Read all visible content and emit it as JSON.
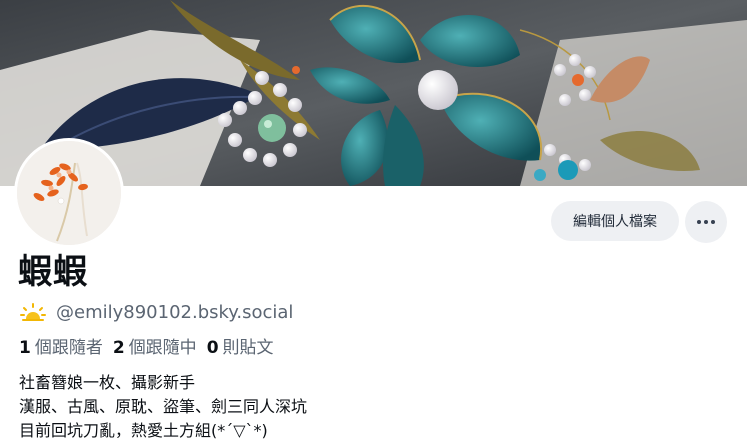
{
  "profile": {
    "display_name": "蝦蝦",
    "handle": "@emily890102.bsky.social",
    "handle_icon": "sun-cloud-emoji-icon"
  },
  "actions": {
    "edit_label": "編輯個人檔案",
    "more_icon": "more-dots-icon"
  },
  "stats": {
    "followers_count": "1",
    "followers_label": "個跟隨者",
    "following_count": "2",
    "following_label": "個跟隨中",
    "posts_count": "0",
    "posts_label": "則貼文"
  },
  "bio": [
    "社畜簪娘一枚、攝影新手",
    "漢服、古風、原耽、盜筆、劍三同人深坑",
    "目前回坑刀亂，熱愛土方組(*´▽`*)"
  ],
  "colors": {
    "accent_teal": "#1f6f78",
    "button_bg": "#eef0f3",
    "muted_text": "#5b6572"
  }
}
